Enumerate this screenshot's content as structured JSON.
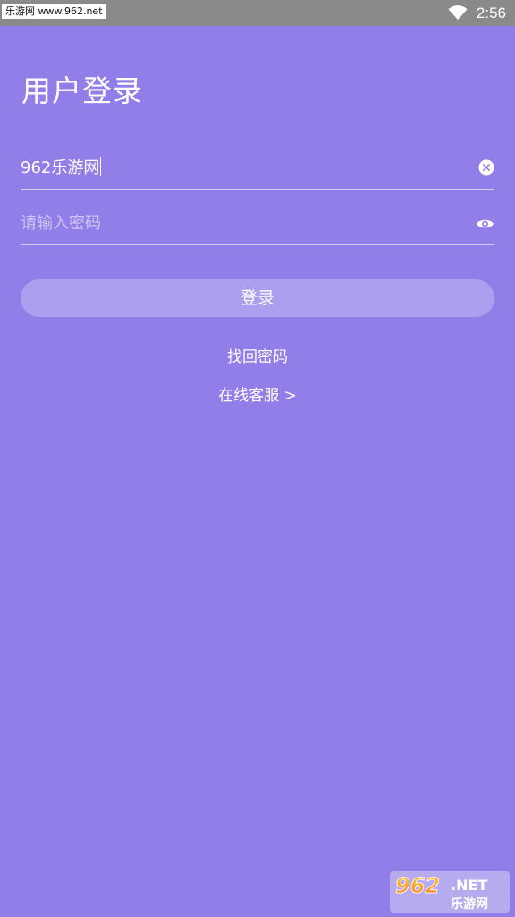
{
  "status_bar": {
    "watermark": "乐游网 www.962.net",
    "time": "2:56",
    "wifi_icon": "wifi-icon"
  },
  "title": "用户登录",
  "form": {
    "username": {
      "value": "962乐游网",
      "clear_icon": "clear-icon"
    },
    "password": {
      "placeholder": "请输入密码",
      "visibility_icon": "eye-icon"
    },
    "login_label": "登录",
    "forgot_label": "找回密码",
    "service_label": "在线客服 >"
  },
  "logo": {
    "text_top": "962.NET",
    "text_bottom": "乐游网"
  },
  "colors": {
    "background": "#917ee9",
    "button": "#ad9ff0",
    "status_bar": "#8a8a8a"
  }
}
